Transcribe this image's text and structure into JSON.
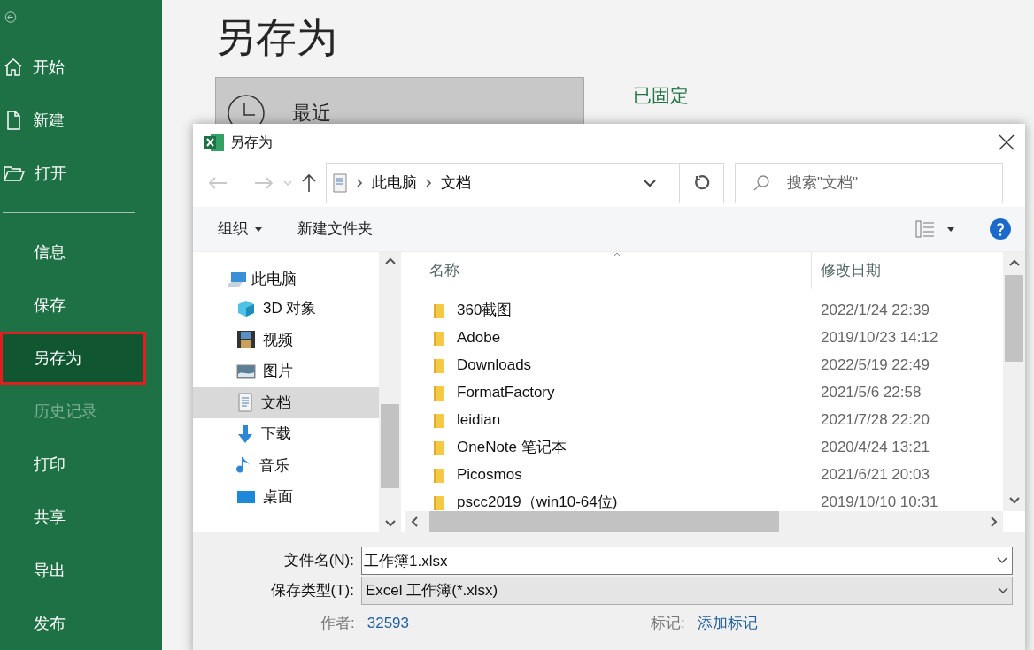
{
  "sidebar": {
    "items": [
      {
        "label": "开始",
        "selected": false,
        "disabled": false,
        "highlighted": false
      },
      {
        "label": "新建",
        "selected": false,
        "disabled": false,
        "highlighted": false
      },
      {
        "label": "打开",
        "selected": false,
        "disabled": false,
        "highlighted": false
      },
      {
        "label": "信息",
        "selected": false,
        "disabled": false,
        "highlighted": false
      },
      {
        "label": "保存",
        "selected": false,
        "disabled": false,
        "highlighted": false
      },
      {
        "label": "另存为",
        "selected": true,
        "disabled": false,
        "highlighted": true
      },
      {
        "label": "历史记录",
        "selected": false,
        "disabled": true,
        "highlighted": false
      },
      {
        "label": "打印",
        "selected": false,
        "disabled": false,
        "highlighted": false
      },
      {
        "label": "共享",
        "selected": false,
        "disabled": false,
        "highlighted": false
      },
      {
        "label": "导出",
        "selected": false,
        "disabled": false,
        "highlighted": false
      },
      {
        "label": "发布",
        "selected": false,
        "disabled": false,
        "highlighted": false
      }
    ]
  },
  "page": {
    "title": "另存为",
    "recent": "最近",
    "pinned": "已固定"
  },
  "dialog": {
    "title": "另存为",
    "breadcrumb": [
      "此电脑",
      "文档"
    ],
    "search": {
      "placeholder": "搜索\"文档\""
    },
    "toolbar": {
      "organize": "组织",
      "new_folder": "新建文件夹"
    },
    "tree": [
      {
        "label": "此电脑",
        "selected": false,
        "children": [
          {
            "label": "3D 对象",
            "selected": false
          },
          {
            "label": "视频",
            "selected": false
          },
          {
            "label": "图片",
            "selected": false
          },
          {
            "label": "文档",
            "selected": true
          },
          {
            "label": "下载",
            "selected": false
          },
          {
            "label": "音乐",
            "selected": false
          },
          {
            "label": "桌面",
            "selected": false
          }
        ]
      }
    ],
    "columns": [
      "名称",
      "修改日期"
    ],
    "files": [
      {
        "name": "360截图",
        "date": "2022/1/24 22:39"
      },
      {
        "name": "Adobe",
        "date": "2019/10/23 14:12"
      },
      {
        "name": "Downloads",
        "date": "2022/5/19 22:49"
      },
      {
        "name": "FormatFactory",
        "date": "2021/5/6 22:58"
      },
      {
        "name": "leidian",
        "date": "2021/7/28 22:20"
      },
      {
        "name": "OneNote 笔记本",
        "date": "2020/4/24 13:21"
      },
      {
        "name": "Picosmos",
        "date": "2021/6/21 20:03"
      },
      {
        "name": "pscc2019（win10-64位)",
        "date": "2019/10/10 10:31"
      }
    ],
    "filename": {
      "label": "文件名(N):",
      "value": "工作簿1.xlsx"
    },
    "filetype": {
      "label": "保存类型(T):",
      "value": "Excel 工作簿(*.xlsx)"
    },
    "meta": [
      {
        "label": "作者:",
        "value": "32593"
      },
      {
        "label": "标记:",
        "value": "添加标记"
      }
    ]
  }
}
